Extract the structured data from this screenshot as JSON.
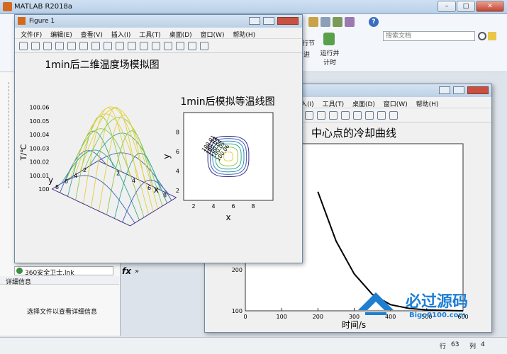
{
  "app": {
    "title": "MATLAB R2018a",
    "search_placeholder": "搜索文档",
    "ribbon_labels": [
      "行节",
      "运行并\n计时",
      "进"
    ],
    "window_buttons": {
      "minimize": "–",
      "maximize": "□",
      "close": "✕"
    }
  },
  "left_panel": {
    "file_entry": "360安全卫士.lnk",
    "details_title": "详细信息",
    "details_msg": "选择文件以查看详细信息"
  },
  "command": {
    "fx": "fx",
    "arrows": "»"
  },
  "status_bar": {
    "row_label": "行",
    "row": "63",
    "col_label": "列",
    "col": "4"
  },
  "watermark": {
    "cn": "必过源码",
    "url": "Bigo0100.com"
  },
  "figure1": {
    "title": "Figure 1",
    "menus": [
      "文件(F)",
      "编辑(E)",
      "查看(V)",
      "插入(I)",
      "工具(T)",
      "桌面(D)",
      "窗口(W)",
      "帮助(H)"
    ],
    "plot3d_title": "1min后二维温度场模拟图",
    "contour_title": "1min后模拟等温线图"
  },
  "figure2": {
    "menus": [
      "入(I)",
      "工具(T)",
      "桌面(D)",
      "窗口(W)",
      "帮助(H)"
    ],
    "title": "中心点的冷却曲线",
    "xlabel": "时间/s"
  },
  "chart_data": [
    {
      "type": "surface",
      "title": "1min后二维温度场模拟图",
      "xlabel": "x",
      "ylabel": "y",
      "zlabel": "T/℃",
      "x_ticks": [
        2,
        4,
        6,
        8
      ],
      "y_ticks": [
        2,
        4,
        6,
        8
      ],
      "z_ticks": [
        100,
        100.01,
        100.02,
        100.03,
        100.04,
        100.05,
        100.06
      ],
      "zlim": [
        100,
        100.065
      ],
      "peak": 100.063
    },
    {
      "type": "contour",
      "title": "1min后模拟等温线图",
      "xlabel": "x",
      "ylabel": "y",
      "x_ticks": [
        2,
        4,
        6,
        8
      ],
      "y_ticks": [
        2,
        4,
        6,
        8
      ],
      "levels": [
        100.01,
        100.02,
        100.03,
        100.04,
        100.05,
        100.06
      ],
      "labels_text": [
        "100.01",
        "100.02",
        "100.03",
        "100.04",
        "100.05",
        "100.06"
      ]
    },
    {
      "type": "line",
      "title": "中心点的冷却曲线",
      "xlabel": "时间/s",
      "x_ticks": [
        0,
        100,
        200,
        300,
        400,
        500,
        600
      ],
      "y_ticks_visible": [
        100,
        200
      ],
      "x": [
        200,
        250,
        300,
        350,
        400,
        450,
        500,
        550,
        600
      ],
      "y": [
        390,
        270,
        190,
        140,
        115,
        106,
        102,
        101,
        100
      ]
    }
  ]
}
